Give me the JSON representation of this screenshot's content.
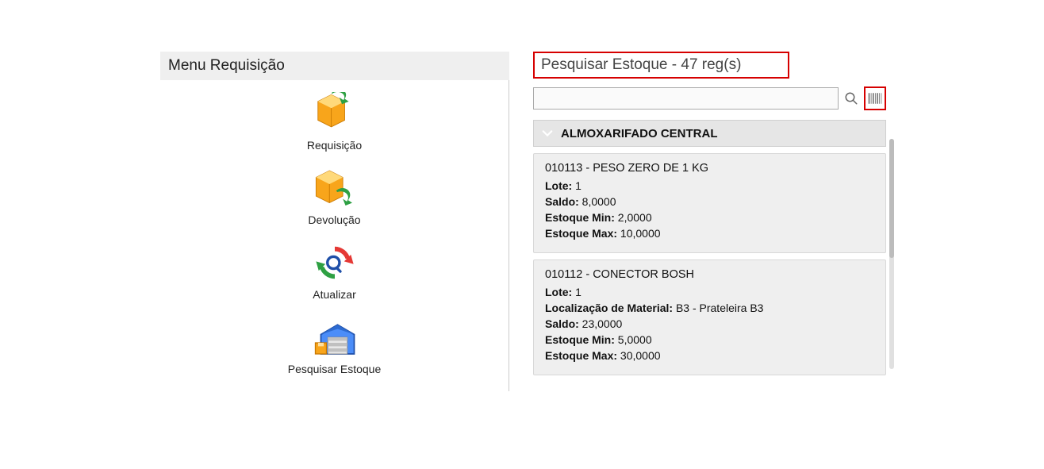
{
  "leftPanel": {
    "title": "Menu Requisição",
    "items": [
      {
        "label": "Requisição"
      },
      {
        "label": "Devolução"
      },
      {
        "label": "Atualizar"
      },
      {
        "label": "Pesquisar Estoque"
      }
    ]
  },
  "rightPanel": {
    "title": "Pesquisar Estoque - 47 reg(s)",
    "searchValue": "",
    "group": {
      "title": "ALMOXARIFADO CENTRAL"
    },
    "items": [
      {
        "title": "010113 - PESO ZERO DE 1 KG",
        "loteLabel": "Lote:",
        "lote": "1",
        "saldoLabel": "Saldo:",
        "saldo": "8,0000",
        "minLabel": "Estoque Min:",
        "min": "2,0000",
        "maxLabel": "Estoque Max:",
        "max": "10,0000"
      },
      {
        "title": "010112 - CONECTOR BOSH",
        "loteLabel": "Lote:",
        "lote": "1",
        "locLabel": "Localização de Material:",
        "loc": "B3 - Prateleira B3",
        "saldoLabel": "Saldo:",
        "saldo": "23,0000",
        "minLabel": "Estoque Min:",
        "min": "5,0000",
        "maxLabel": "Estoque Max:",
        "max": "30,0000"
      }
    ]
  }
}
